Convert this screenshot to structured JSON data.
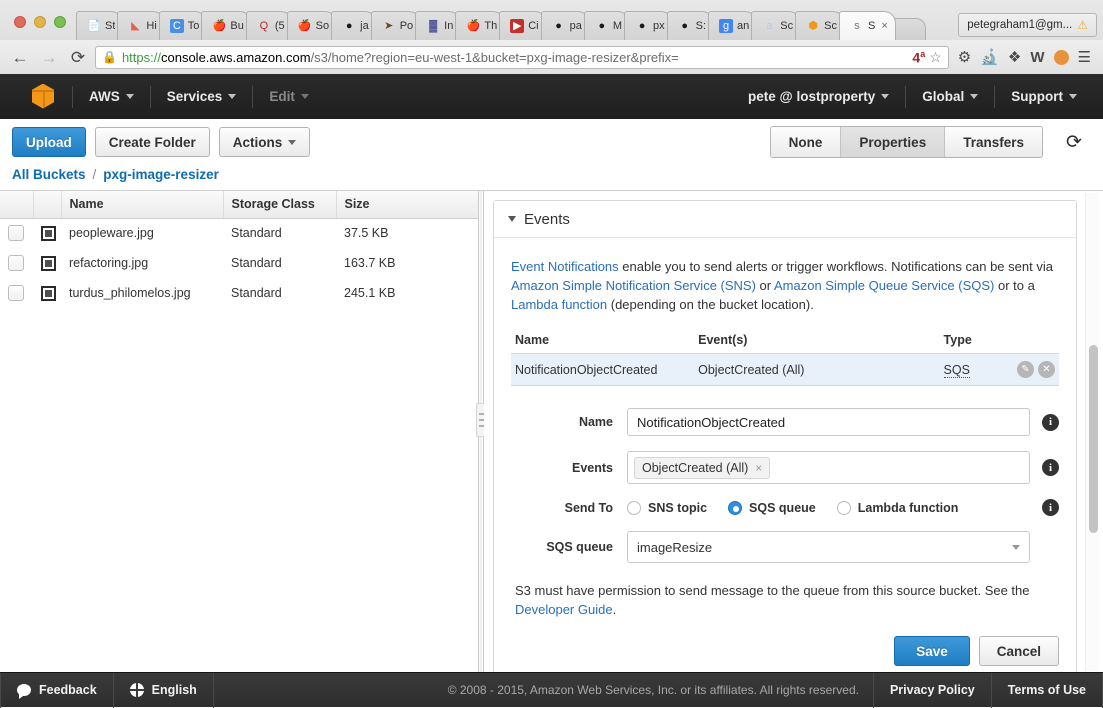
{
  "browser": {
    "tabs": [
      {
        "label": "St",
        "icon": "page-icon",
        "active": false
      },
      {
        "label": "Hi",
        "icon": "hipchat-icon",
        "active": false
      },
      {
        "label": "To",
        "icon": "c-icon",
        "active": false
      },
      {
        "label": "Bu",
        "icon": "apple-icon",
        "active": false
      },
      {
        "label": "(5",
        "icon": "quora-icon",
        "active": false
      },
      {
        "label": "So",
        "icon": "apple-icon",
        "active": false
      },
      {
        "label": "ja",
        "icon": "github-icon",
        "active": false
      },
      {
        "label": "Po",
        "icon": "postman-icon",
        "active": false
      },
      {
        "label": "In",
        "icon": "invision-icon",
        "active": false
      },
      {
        "label": "Th",
        "icon": "apple-icon",
        "active": false
      },
      {
        "label": "Ci",
        "icon": "youtube-icon",
        "active": false
      },
      {
        "label": "pa",
        "icon": "github-icon",
        "active": false
      },
      {
        "label": "M",
        "icon": "github-icon",
        "active": false
      },
      {
        "label": "px",
        "icon": "github-icon",
        "active": false
      },
      {
        "label": "S:",
        "icon": "github-icon",
        "active": false
      },
      {
        "label": "an",
        "icon": "google-icon",
        "active": false
      },
      {
        "label": "Sc",
        "icon": "amazon-icon",
        "active": false
      },
      {
        "label": "Sc",
        "icon": "aws-cube-icon",
        "active": false
      },
      {
        "label": "S",
        "icon": "aws-s3-icon",
        "active": true
      }
    ],
    "profile_label": "petegraham1@gm...",
    "url": {
      "scheme": "https://",
      "domain": "console.aws.amazon.com",
      "path": "/s3/home?region=eu-west-1&bucket=pxg-image-resizer&prefix=",
      "full": "https://console.aws.amazon.com/s3/home?region=eu-west-1&bucket=pxg-image-resizer&prefix="
    },
    "badge_count": "4",
    "badge_sup": "a"
  },
  "aws_nav": {
    "logo": "aws-cube-logo",
    "items": [
      {
        "label": "AWS",
        "dim": false,
        "caret": true
      },
      {
        "label": "Services",
        "dim": false,
        "caret": true
      },
      {
        "label": "Edit",
        "dim": true,
        "caret": true
      }
    ],
    "right_items": [
      {
        "label": "pete @ lostproperty",
        "caret": true
      },
      {
        "label": "Global",
        "caret": true
      },
      {
        "label": "Support",
        "caret": true
      }
    ]
  },
  "toolbar": {
    "upload_label": "Upload",
    "create_folder_label": "Create Folder",
    "actions_label": "Actions",
    "segments": [
      {
        "label": "None",
        "active": false
      },
      {
        "label": "Properties",
        "active": true
      },
      {
        "label": "Transfers",
        "active": false
      }
    ],
    "refresh_icon": "refresh-icon"
  },
  "breadcrumb": {
    "root": "All Buckets",
    "separator": "/",
    "current": "pxg-image-resizer"
  },
  "objects": {
    "columns": [
      "",
      "",
      "Name",
      "Storage Class",
      "Size"
    ],
    "rows": [
      {
        "name": "peopleware.jpg",
        "storage_class": "Standard",
        "size": "37.5 KB"
      },
      {
        "name": "refactoring.jpg",
        "storage_class": "Standard",
        "size": "163.7 KB"
      },
      {
        "name": "turdus_philomelos.jpg",
        "storage_class": "Standard",
        "size": "245.1 KB"
      }
    ]
  },
  "events_panel": {
    "title": "Events",
    "description": {
      "link1": "Event Notifications",
      "text1": " enable you to send alerts or trigger workflows. Notifications can be sent via ",
      "link2": "Amazon Simple Notification Service (SNS)",
      "text2": " or ",
      "link3": "Amazon Simple Queue Service (SQS)",
      "text3": " or to a ",
      "link4": "Lambda function",
      "text4": " (depending on the bucket location)."
    },
    "table": {
      "columns": [
        "Name",
        "Event(s)",
        "Type",
        ""
      ],
      "rows": [
        {
          "name": "NotificationObjectCreated",
          "events": "ObjectCreated (All)",
          "type": "SQS",
          "edit_icon": "pencil-icon",
          "delete_icon": "close-circle-icon"
        }
      ]
    },
    "form": {
      "name_label": "Name",
      "name_value": "NotificationObjectCreated",
      "events_label": "Events",
      "events_tag": "ObjectCreated (All)",
      "events_tag_remove": "×",
      "send_to_label": "Send To",
      "send_to_options": [
        {
          "label": "SNS topic",
          "selected": false
        },
        {
          "label": "SQS queue",
          "selected": true
        },
        {
          "label": "Lambda function",
          "selected": false
        }
      ],
      "queue_label": "SQS queue",
      "queue_value": "imageResize",
      "info_icon": "info-icon"
    },
    "note": {
      "text": "S3 must have permission to send message to the queue from this source bucket. See the ",
      "link": "Developer Guide",
      "suffix": "."
    },
    "save_label": "Save",
    "cancel_label": "Cancel"
  },
  "footer": {
    "feedback_label": "Feedback",
    "language_label": "English",
    "copyright": "© 2008 - 2015, Amazon Web Services, Inc. or its affiliates. All rights reserved.",
    "privacy_label": "Privacy Policy",
    "terms_label": "Terms of Use"
  },
  "colors": {
    "aws_orange": "#f49718",
    "primary_blue": "#1f7ec4",
    "link_blue": "#2a6ebb",
    "row_highlight": "#e8f1fa",
    "nav_dark": "#2b2b2b"
  }
}
